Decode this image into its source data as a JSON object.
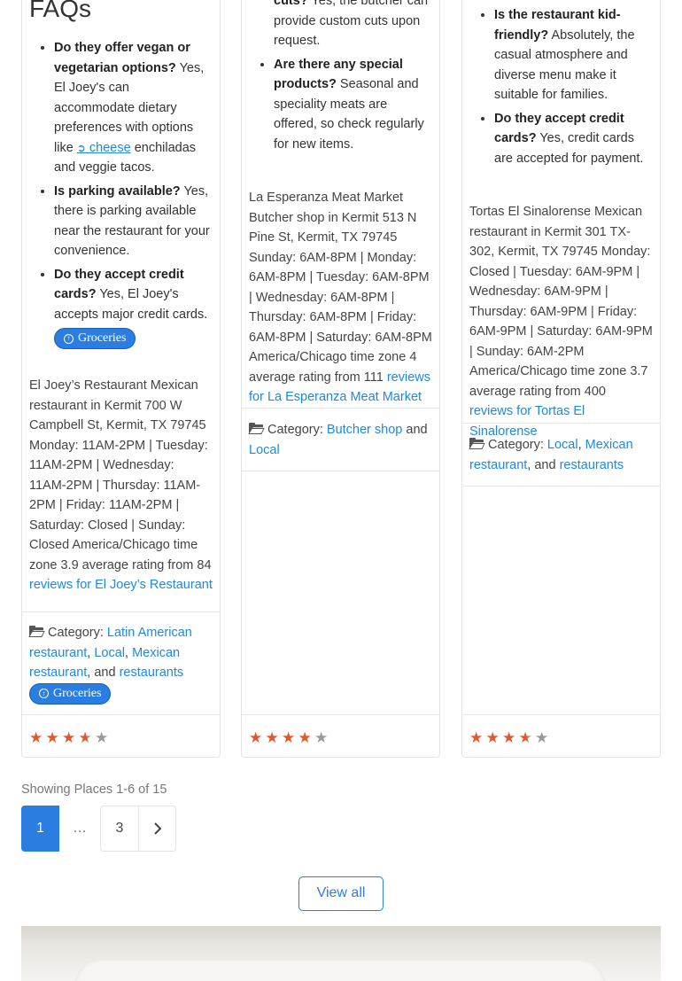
{
  "col1": {
    "faq_title": "FAQs",
    "faqs": [
      {
        "q": "Do they offer vegan or vegetarian options?",
        "a1": "Yes, El Joey's can accommodate dietary preferences with options like",
        "link": "cheese",
        "a2": "enchiladas and veggie tacos."
      },
      {
        "q": "Is parking available?",
        "a": "Yes, there is parking available near the restaurant for your convenience."
      },
      {
        "q": "Do they accept credit cards?",
        "a": "Yes, El Joey's accepts major credit cards."
      }
    ],
    "pill": "Groceries",
    "desc": "El Joey’s Restaurant Mexican restaurant in Kermit 700 W Campbell St, Kermit, TX 79745 Monday: 11AM-2PM | Tuesday: 11AM-2PM | Wednesday: 11AM-2PM | Thursday: 11AM-2PM | Friday: 11AM-2PM | Saturday: Closed | Sunday: Closed America/Chicago time zone 3.9 average rating from 84",
    "reviews_link": "reviews for El Joey’s Restaurant",
    "category_label": "Category:",
    "categories": [
      "Latin American restaurant",
      "Local",
      "Mexican restaurant",
      "restaurants"
    ],
    "sep_comma": ",",
    "sep_and": ", and",
    "pill2": "Groceries",
    "rating": 3.9
  },
  "col2": {
    "faqs": [
      {
        "q": "cuts?",
        "a": "Yes, the butcher can provide custom cuts upon request."
      },
      {
        "q": "Are there any special products?",
        "a": "Seasonal and speciality meats are offered, so check regularly for new items."
      }
    ],
    "desc": "La Esperanza Meat Market Butcher shop in Kermit 513 N Pine St, Kermit, TX 79745 Sunday: 6AM-8PM | Monday: 6AM-8PM | Tuesday: 6AM-8PM | Wednesday: 6AM-8PM | Thursday: 6AM-8PM | Friday: 6AM-8PM | Saturday: 6AM-8PM America/Chicago time zone 4 average rating from 111",
    "reviews_link": "reviews for La Esperanza Meat Market",
    "category_label": "Category:",
    "categories": [
      "Butcher shop",
      "Local"
    ],
    "sep_and": "and",
    "rating": 4
  },
  "col3": {
    "faqs": [
      {
        "q": "Is the restaurant kid-friendly?",
        "a": "Absolutely, the casual atmosphere and diverse menu make it suitable for families."
      },
      {
        "q": "Do they accept credit cards?",
        "a": "Yes, credit cards are accepted for payment."
      }
    ],
    "desc": "Tortas El Sinalorense Mexican restaurant in Kermit 301 TX-302, Kermit, TX 79745 Monday: Closed | Tuesday: 6AM-9PM | Wednesday: 6AM-9PM | Thursday: 6AM-9PM | Friday: 6AM-9PM | Saturday: 6AM-9PM | Sunday: 6AM-2PM America/Chicago time zone 3.7 average rating from 400",
    "reviews_link": "reviews for Tortas El Sinalorense",
    "category_label": "Category:",
    "categories": [
      "Local",
      "Mexican restaurant",
      "restaurants"
    ],
    "sep_comma": ",",
    "sep_and": ", and",
    "rating": 3.7
  },
  "pagination": {
    "showing": "Showing Places 1-6 of 15",
    "current": "1",
    "dots": "…",
    "page3": "3",
    "next_icon": "chevron-right-icon"
  },
  "view_all": "View all",
  "colors": {
    "accent": "#2a7de1",
    "link": "#1e88e5",
    "star": "#e2582e",
    "star_off": "#999999"
  }
}
